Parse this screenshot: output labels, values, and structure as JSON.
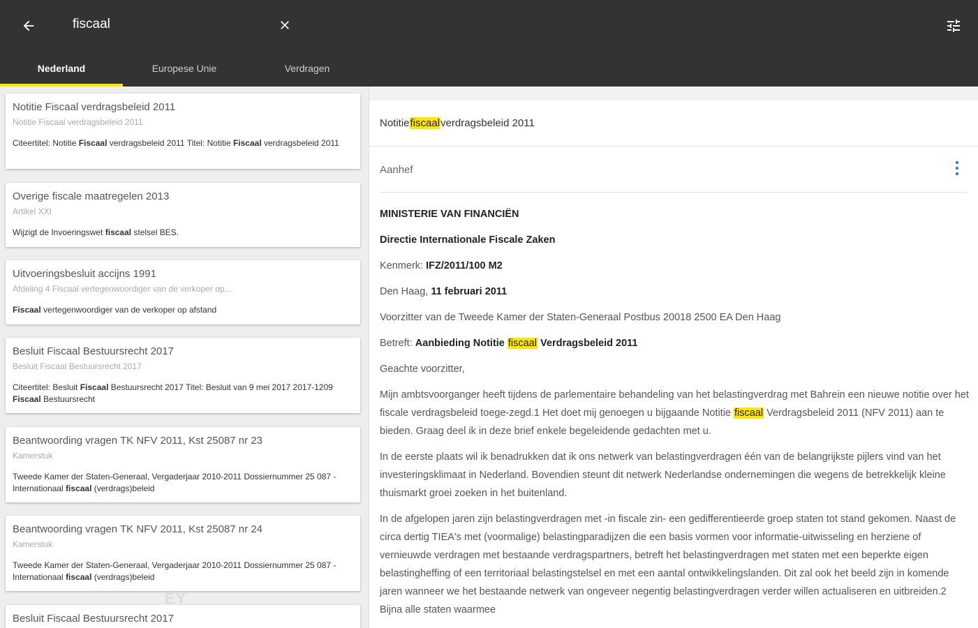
{
  "search": {
    "query": "fiscaal"
  },
  "tabs": [
    {
      "label": "Nederland",
      "active": true
    },
    {
      "label": "Europese Unie",
      "active": false
    },
    {
      "label": "Verdragen",
      "active": false
    }
  ],
  "results": [
    {
      "title": "Notitie Fiscaal verdragsbeleid 2011",
      "subtitle": "Notitie Fiscaal verdragsbeleid 2011",
      "snippet": [
        "Citeertitel: Notitie ",
        "Fiscaal",
        " verdragsbeleid 2011 Titel: Notitie ",
        "Fiscaal",
        " verdragsbeleid 2011"
      ]
    },
    {
      "title": "Overige fiscale maatregelen 2013",
      "subtitle": "Artikel XXI",
      "snippet": [
        "Wijzigt de Invoeringswet ",
        "fiscaal",
        " stelsel BES."
      ]
    },
    {
      "title": "Uitvoeringsbesluit accijns 1991",
      "subtitle": "Afdeling 4 Fiscaal vertegenwoordiger van de verkoper op...",
      "snippet": [
        "",
        "Fiscaal",
        " vertegenwoordiger van de verkoper op afstand"
      ]
    },
    {
      "title": "Besluit Fiscaal Bestuursrecht 2017",
      "subtitle": "Besluit Fiscaal Bestuursrecht 2017",
      "snippet": [
        "Citeertitel: Besluit ",
        "Fiscaal",
        " Bestuursrecht 2017 Titel: Besluit van 9 mei 2017 2017-1209 ",
        "Fiscaal",
        " Bestuursrecht"
      ]
    },
    {
      "title": "Beantwoording vragen TK NFV 2011, Kst 25087 nr 23",
      "subtitle": "Kamerstuk",
      "snippet": [
        "Tweede Kamer der Staten-Generaal, Vergaderjaar 2010-2011 Dossiernummer 25 087 - Internationaal ",
        "fiscaal",
        " (verdrags)beleid"
      ]
    },
    {
      "title": "Beantwoording vragen TK NFV 2011, Kst 25087 nr 24",
      "subtitle": "Kamerstuk",
      "snippet": [
        "Tweede Kamer der Staten-Generaal, Vergaderjaar 2010-2011 Dossiernummer 25 087 - Internationaal ",
        "fiscaal",
        " (verdrags)beleid"
      ]
    },
    {
      "title": "Besluit Fiscaal Bestuursrecht 2017",
      "subtitle": "",
      "snippet": []
    }
  ],
  "watermark": "EY",
  "document": {
    "title": [
      "Notitie ",
      "fiscaal",
      " verdragsbeleid 2011"
    ],
    "section": "Aanhef",
    "ministry": "MINISTERIE VAN FINANCIËN",
    "directorate": "Directie Internationale Fiscale Zaken",
    "kenmerk_label": "Kenmerk: ",
    "kenmerk_value": "IFZ/2011/100 M2",
    "place_label": "Den Haag, ",
    "date": "11 februari 2011",
    "addressee": "Voorzitter van de Tweede Kamer der Staten-Generaal Postbus 20018 2500 EA Den Haag",
    "betreft_label": "Betreft: ",
    "betreft": [
      "Aanbieding Notitie ",
      "fiscaal",
      " Verdragsbeleid 2011"
    ],
    "salutation": "Geachte voorzitter,",
    "p1": [
      "Mijn ambtsvoorganger heeft tijdens de parlementaire behandeling van het belastingverdrag met Bahrein een nieuwe notitie over het fiscale verdragsbeleid toege-zegd.1 Het doet mij genoegen u bijgaande Notitie ",
      "fiscaal",
      " Verdragsbeleid 2011 (NFV 2011) aan te bieden. Graag deel ik in deze brief enkele begeleidende gedachten met u."
    ],
    "p2": "In de eerste plaats wil ik benadrukken dat ik ons netwerk van belastingverdragen één van de belangrijkste pijlers vind van het investeringsklimaat in Nederland. Bovendien steunt dit netwerk Nederlandse ondernemingen die wegens de betrekkelijk kleine thuismarkt groei zoeken in het buitenland.",
    "p3": "In de afgelopen jaren zijn belastingverdragen met -in fiscale zin- een gedifferentieerde groep staten tot stand gekomen. Naast de circa dertig TIEA's met (voormalige) belastingparadijzen die een basis vormen voor informatie-uitwisseling en herziene of vernieuwde verdragen met bestaande verdragspartners, betreft het belastingverdragen met staten met een beperkte eigen belastingheffing of een territoriaal belastingstelsel en met een aantal ontwikkelingslanden. Dit zal ook het beeld zijn in komende jaren wanneer we het bestaande netwerk van ongeveer negentig belastingverdragen verder willen actualiseren en uitbreiden.2 Bijna alle staten waarmee"
  }
}
